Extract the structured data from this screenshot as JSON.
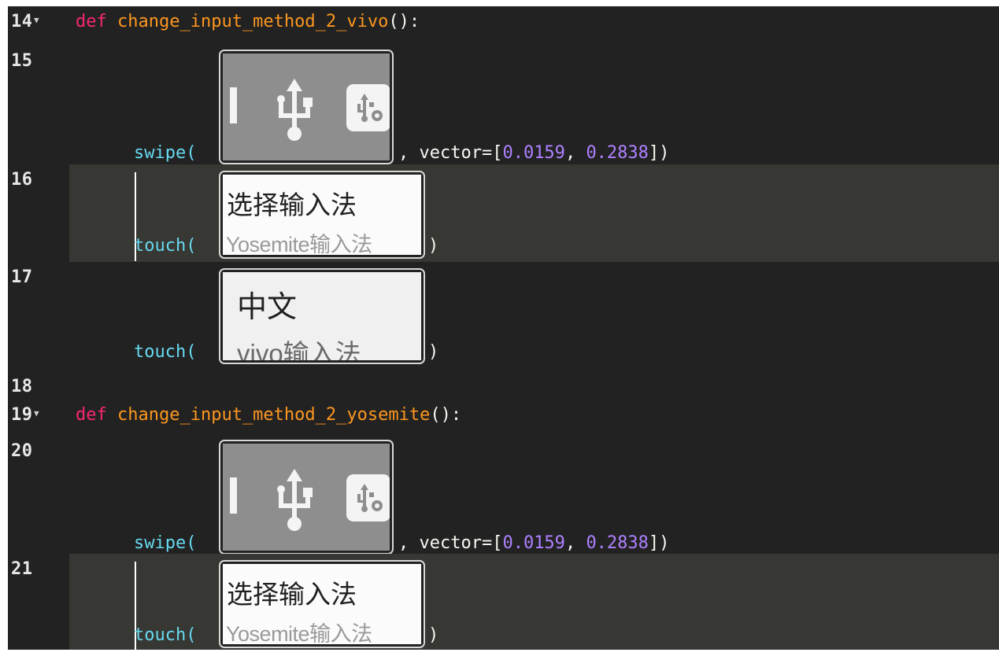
{
  "lines": [
    {
      "num": "14",
      "keyword": "def",
      "name": "change_input_method_2_vivo",
      "suffix": "():"
    },
    {
      "num": "15",
      "call": "swipe",
      "paren": "(",
      "rest": ", vector=[",
      "v1": "0.0159",
      "sep": ", ",
      "v2": "0.2838",
      "end": "])"
    },
    {
      "num": "16",
      "call": "touch",
      "paren": "(",
      "end": ")"
    },
    {
      "num": "17",
      "call": "touch",
      "paren": "(",
      "end": ")"
    },
    {
      "num": "18"
    },
    {
      "num": "19",
      "keyword": "def",
      "name": "change_input_method_2_yosemite",
      "suffix": "():"
    },
    {
      "num": "20",
      "call": "swipe",
      "paren": "(",
      "rest": ", vector=[",
      "v1": "0.0159",
      "sep": ", ",
      "v2": "0.2838",
      "end": "])"
    },
    {
      "num": "21",
      "call": "touch",
      "paren": "(",
      "end": ")"
    }
  ],
  "thumbnails": {
    "input_method_select": {
      "title": "选择输入法",
      "subtitle": "Yosemite输入法"
    },
    "chinese_option": {
      "title": "中文",
      "subtitle": "vivo输入法"
    }
  },
  "colors": {
    "background": "#222222",
    "highlight": "#373733",
    "keyword": "#f92672",
    "function": "#fd971f",
    "call": "#66d9ef",
    "number": "#ae81ff"
  }
}
